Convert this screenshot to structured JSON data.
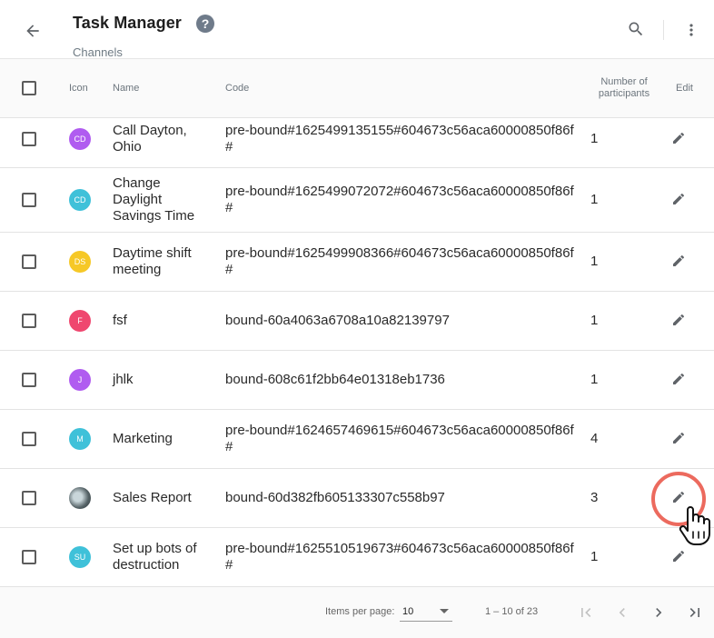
{
  "header": {
    "title": "Task Manager",
    "help": "?",
    "subtitle": "Channels"
  },
  "columns": {
    "icon": "Icon",
    "name": "Name",
    "code": "Code",
    "participants": "Number of participants",
    "edit": "Edit"
  },
  "rows": [
    {
      "initials": "CD",
      "avatar_color": "#b05cf0",
      "name": "Call Dayton, Ohio",
      "code": "pre-bound#1625499135155#604673c56aca60000850f86f#",
      "participants": "1"
    },
    {
      "initials": "CD",
      "avatar_color": "#3fc1d9",
      "name": "Change Daylight Savings Time",
      "code": "pre-bound#1625499072072#604673c56aca60000850f86f#",
      "participants": "1"
    },
    {
      "initials": "DS",
      "avatar_color": "#f6c827",
      "name": "Daytime shift meeting",
      "code": "pre-bound#1625499908366#604673c56aca60000850f86f#",
      "participants": "1"
    },
    {
      "initials": "F",
      "avatar_color": "#ef476f",
      "name": "fsf",
      "code": "bound-60a4063a6708a10a82139797",
      "participants": "1"
    },
    {
      "initials": "J",
      "avatar_color": "#b05cf0",
      "name": "jhlk",
      "code": "bound-608c61f2bb64e01318eb1736",
      "participants": "1"
    },
    {
      "initials": "M",
      "avatar_color": "#3fc1d9",
      "name": "Marketing",
      "code": "pre-bound#1624657469615#604673c56aca60000850f86f#",
      "participants": "4"
    },
    {
      "initials": "",
      "avatar_color": "#7d8a8e",
      "name": "Sales Report",
      "code": "bound-60d382fb605133307c558b97",
      "participants": "3"
    },
    {
      "initials": "SU",
      "avatar_color": "#3fc1d9",
      "name": "Set up bots of destruction",
      "code": "pre-bound#1625510519673#604673c56aca60000850f86f#",
      "participants": "1"
    }
  ],
  "pagination": {
    "items_per_page_label": "Items per page:",
    "items_per_page": "10",
    "range": "1 – 10 of 23"
  },
  "colors": {
    "accent_ring": "#ec6a5e",
    "icon_gray": "#5f6368"
  }
}
